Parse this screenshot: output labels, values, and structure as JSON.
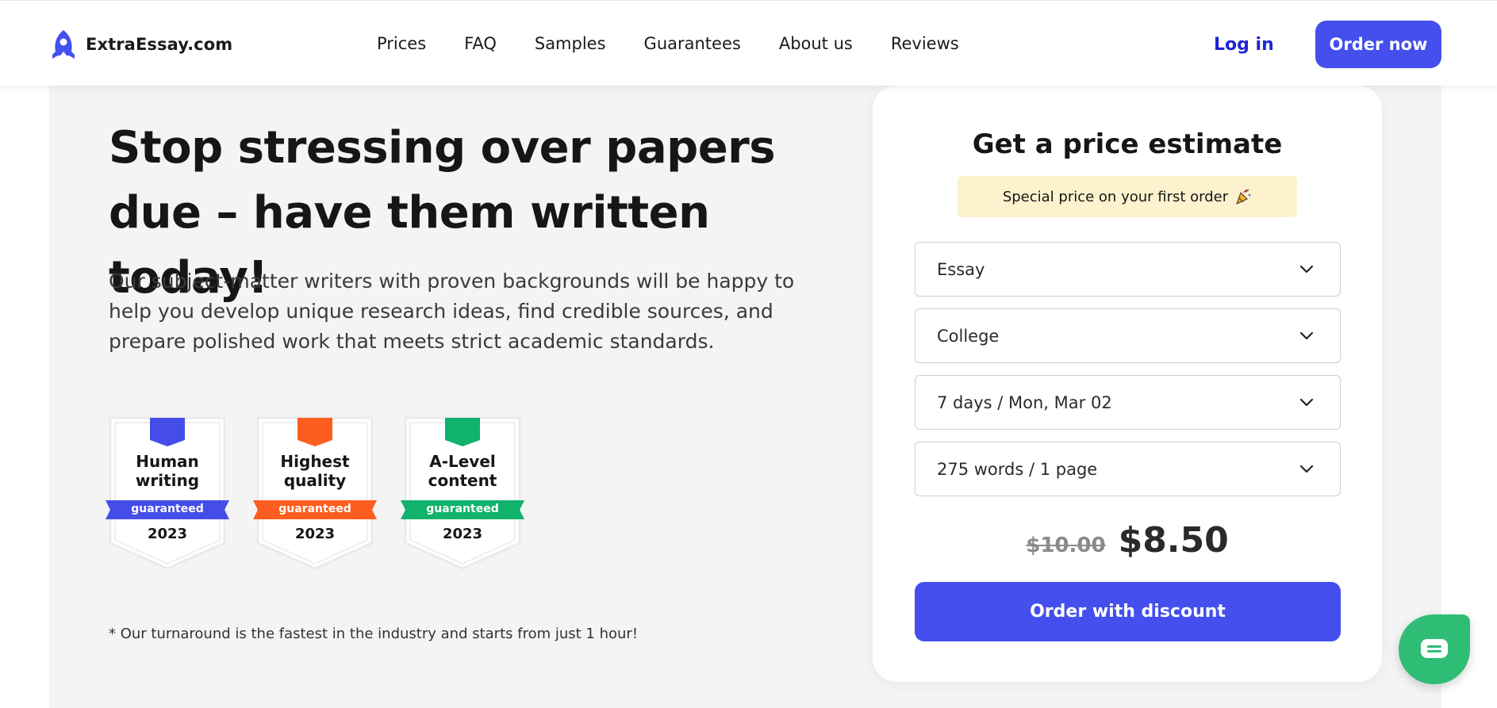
{
  "header": {
    "logo_text": "ExtraEssay.com",
    "nav": [
      "Prices",
      "FAQ",
      "Samples",
      "Guarantees",
      "About us",
      "Reviews"
    ],
    "login_label": "Log in",
    "order_now_label": "Order now"
  },
  "hero": {
    "headline": "Stop stressing over papers due – have them written today!",
    "lead": "Our subject-matter writers with proven backgrounds will be happy to help you develop unique research ideas, find credible sources, and prepare polished work that meets strict academic standards.",
    "badges": [
      {
        "title": "Human writing",
        "ribbon": "guaranteed",
        "year": "2023",
        "color": "#454de8"
      },
      {
        "title": "Highest quality",
        "ribbon": "guaranteed",
        "year": "2023",
        "color": "#fd5e1f"
      },
      {
        "title": "A-Level content",
        "ribbon": "guaranteed",
        "year": "2023",
        "color": "#10b26c"
      }
    ],
    "footnote": "* Our turnaround is the fastest in the industry and starts from just 1 hour!"
  },
  "price_card": {
    "title": "Get a price estimate",
    "promo": "Special price on your first order",
    "selects": {
      "paper_type": "Essay",
      "academic_level": "College",
      "deadline": "7 days / Mon, Mar 02",
      "length": "275 words / 1 page"
    },
    "old_price": "$10.00",
    "new_price": "$8.50",
    "cta_label": "Order with discount"
  },
  "colors": {
    "accent": "#444fee",
    "link": "#1d27d4",
    "promo_bg": "#fdf2cd",
    "chat": "#2fbd76"
  },
  "icons": [
    "rocket-logo-icon",
    "chevron-down-icon",
    "party-popper-icon",
    "chat-icon"
  ]
}
